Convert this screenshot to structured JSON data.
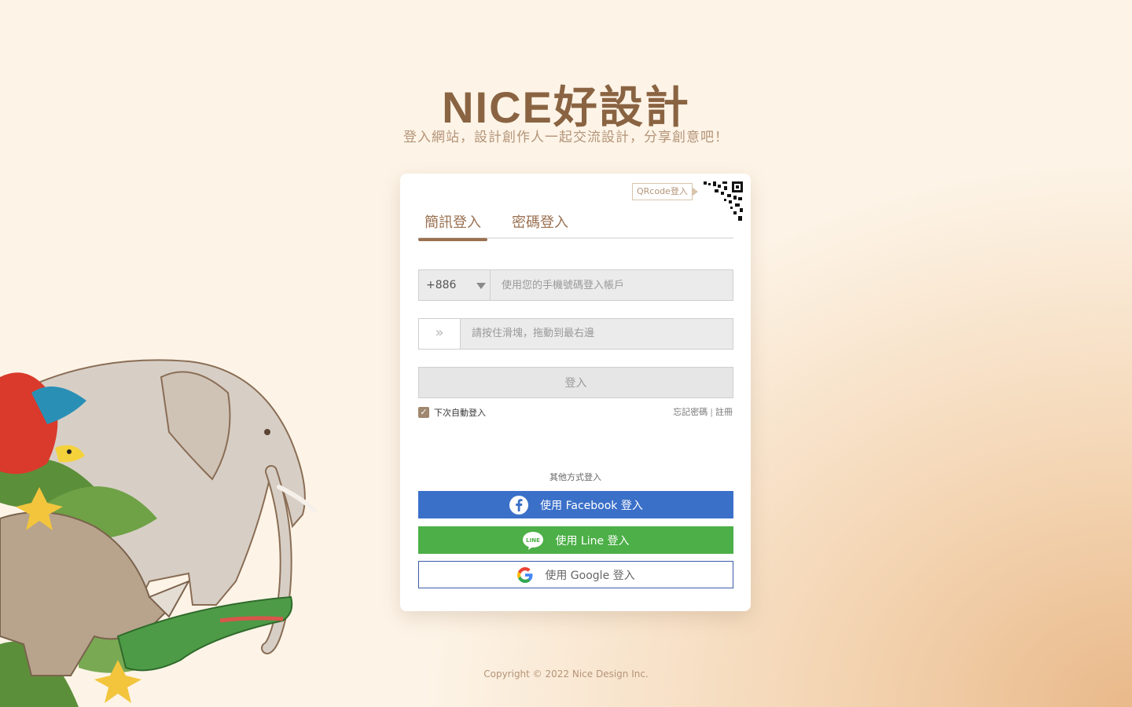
{
  "brand": {
    "logo_text": "NICE好設計",
    "tagline": "登入網站，設計創作人一起交流設計，分享創意吧！"
  },
  "qrcode": {
    "label": "QRcode登入"
  },
  "tabs": [
    {
      "label": "簡訊登入",
      "active": true
    },
    {
      "label": "密碼登入",
      "active": false
    }
  ],
  "phone": {
    "country_code": "+886",
    "placeholder": "使用您的手機號碼登入帳戶",
    "value": ""
  },
  "slider": {
    "text": "請按住滑塊，拖動到最右邊",
    "icon": "double-chevron-right-icon"
  },
  "login_button": {
    "label": "登入"
  },
  "remember": {
    "label": "下次自動登入",
    "checked": true
  },
  "links": {
    "forgot_password": "忘記密碼",
    "separator": "|",
    "register": "註冊"
  },
  "other_login": {
    "label": "其他方式登入",
    "facebook": "使用 Facebook 登入",
    "line": "使用 Line 登入",
    "line_icon_text": "LINE",
    "google": "使用 Google 登入"
  },
  "footer": {
    "copyright": "Copyright © 2022 Nice Design Inc."
  },
  "colors": {
    "brand_brown": "#8a6442",
    "facebook_blue": "#3b70c9",
    "line_green": "#4caf47",
    "google_border": "#3b5ca8"
  }
}
